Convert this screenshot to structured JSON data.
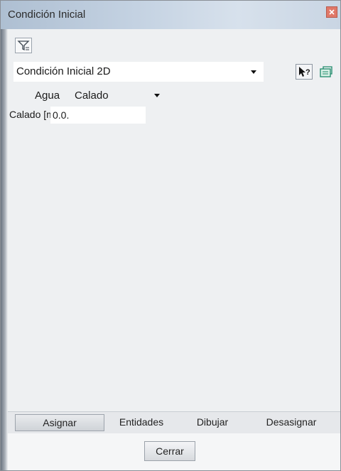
{
  "window": {
    "title": "Condición Inicial"
  },
  "toolbar": {
    "filter_icon": "filter-icon"
  },
  "condition_select": {
    "value": "Condición Inicial 2D"
  },
  "help_icon": "help-pointer-icon",
  "export_icon": "export-icon",
  "agua": {
    "label": "Agua",
    "selected": "Calado"
  },
  "calado": {
    "label": "Calado [m]",
    "value": "0.0."
  },
  "actions": {
    "assign": "Asignar",
    "entities": "Entidades",
    "draw": "Dibujar",
    "unassign": "Desasignar"
  },
  "footer": {
    "close": "Cerrar"
  },
  "colors": {
    "titlebar": "#c4d2e2",
    "window_bg": "#eef0f2",
    "close_button": "#e07868"
  }
}
